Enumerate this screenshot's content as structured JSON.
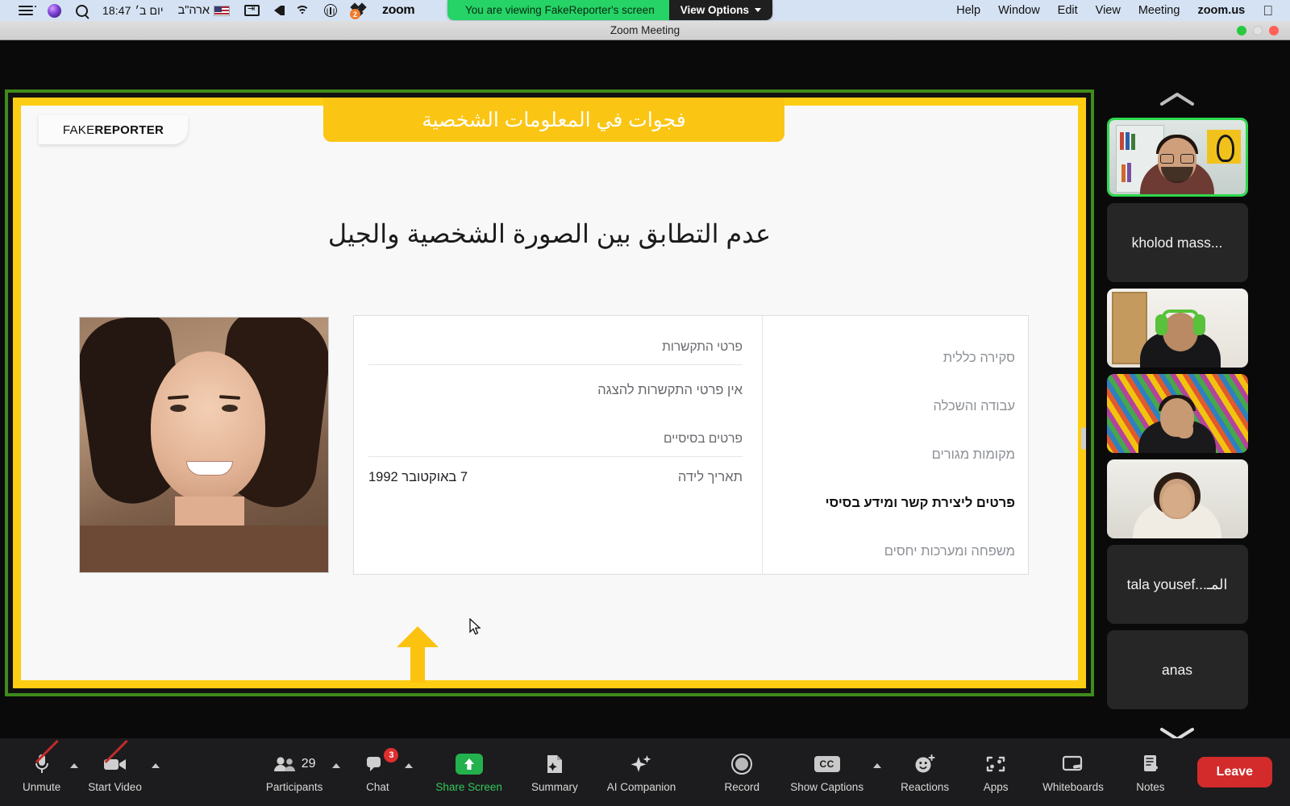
{
  "macbar": {
    "clock": "18:47",
    "day": "יום ב׳",
    "input_source": "ארה\"ב",
    "zoom_label": "zoom",
    "dropbox_badge": "2",
    "menus": [
      "Help",
      "Window",
      "Edit",
      "View",
      "Meeting",
      "zoom.us"
    ],
    "apple_glyph": ""
  },
  "share_banner": {
    "message": "You are viewing FakeReporter's screen",
    "view_options": "View Options",
    "accent_color": "#25d366"
  },
  "window": {
    "title": "Zoom Meeting"
  },
  "slide": {
    "logo_part1": "FAKE",
    "logo_part2": "REPORTER",
    "title_bar": "فجوات في المعلومات الشخصية",
    "heading": "عدم التطابق بين الصورة الشخصية والجيل",
    "accent_yellow": "#fccd12",
    "profile_card": {
      "nav_items": [
        "סקירה כללית",
        "עבודה והשכלה",
        "מקומות מגורים",
        "פרטים ליצירת קשר ומידע בסיסי",
        "משפחה ומערכות יחסים"
      ],
      "active_nav_index": 3,
      "contact_section_title": "פרטי התקשרות",
      "contact_empty": "אין פרטי התקשרות להצגה",
      "basic_section_title": "פרטים בסיסיים",
      "birth_label": "תאריך לידה",
      "birth_value": "7 באוקטובר 1992"
    }
  },
  "participants": [
    {
      "name": "",
      "type": "video",
      "active": true
    },
    {
      "name": "kholod mass...",
      "type": "name"
    },
    {
      "name": "",
      "type": "video"
    },
    {
      "name": "",
      "type": "video"
    },
    {
      "name": "",
      "type": "video"
    },
    {
      "name": "tala yousef...المـ",
      "type": "name"
    },
    {
      "name": "anas",
      "type": "name"
    }
  ],
  "toolbar": {
    "unmute": "Unmute",
    "start_video": "Start Video",
    "participants": "Participants",
    "participants_count": "29",
    "chat": "Chat",
    "chat_badge": "3",
    "share_screen": "Share Screen",
    "summary": "Summary",
    "ai_companion": "AI Companion",
    "record": "Record",
    "show_captions": "Show Captions",
    "captions_glyph": "CC",
    "reactions": "Reactions",
    "apps": "Apps",
    "whiteboards": "Whiteboards",
    "notes": "Notes",
    "leave": "Leave",
    "leave_color": "#d32b2b",
    "active_color": "#35c75a"
  }
}
